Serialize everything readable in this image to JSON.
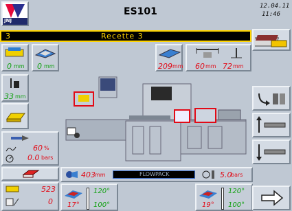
{
  "header": {
    "logo_text": "JNJ",
    "machine_id": "ES101",
    "date": "12.04.11",
    "time": "11:46"
  },
  "recipe": {
    "number": "3",
    "name": "Recette 3"
  },
  "measures_top": {
    "a": {
      "value": "0",
      "unit": "mm"
    },
    "b": {
      "value": "0",
      "unit": "mm"
    },
    "c": {
      "value": "209",
      "unit": "mm"
    },
    "d": {
      "value": "60",
      "unit": "mm"
    },
    "e": {
      "value": "72",
      "unit": "mm"
    }
  },
  "left_panel": {
    "height": {
      "value": "33",
      "unit": "mm"
    },
    "percent": {
      "value": "60",
      "unit": "%"
    },
    "pressure": {
      "value": "0.0",
      "unit": "bars"
    },
    "counter_1": "523",
    "counter_2": "0"
  },
  "bottom_bar": {
    "film_length": {
      "value": "403",
      "unit": "mm"
    },
    "mode_label": "FLOWPACK",
    "air_pressure": {
      "value": "5.0",
      "unit": "bars"
    },
    "temp_left_actual": "17°",
    "temp_left_set": "120°",
    "temp_left_max": "100°",
    "temp_right_actual": "19°",
    "temp_right_set": "120°",
    "temp_right_max": "100°"
  },
  "colors": {
    "background": "#bfc8d3",
    "value_red": "#e20a16",
    "value_green": "#10a010",
    "recipe_bar_bg": "#000000",
    "recipe_bar_text": "#ffd400",
    "recipe_bar_border": "#ffd400"
  }
}
